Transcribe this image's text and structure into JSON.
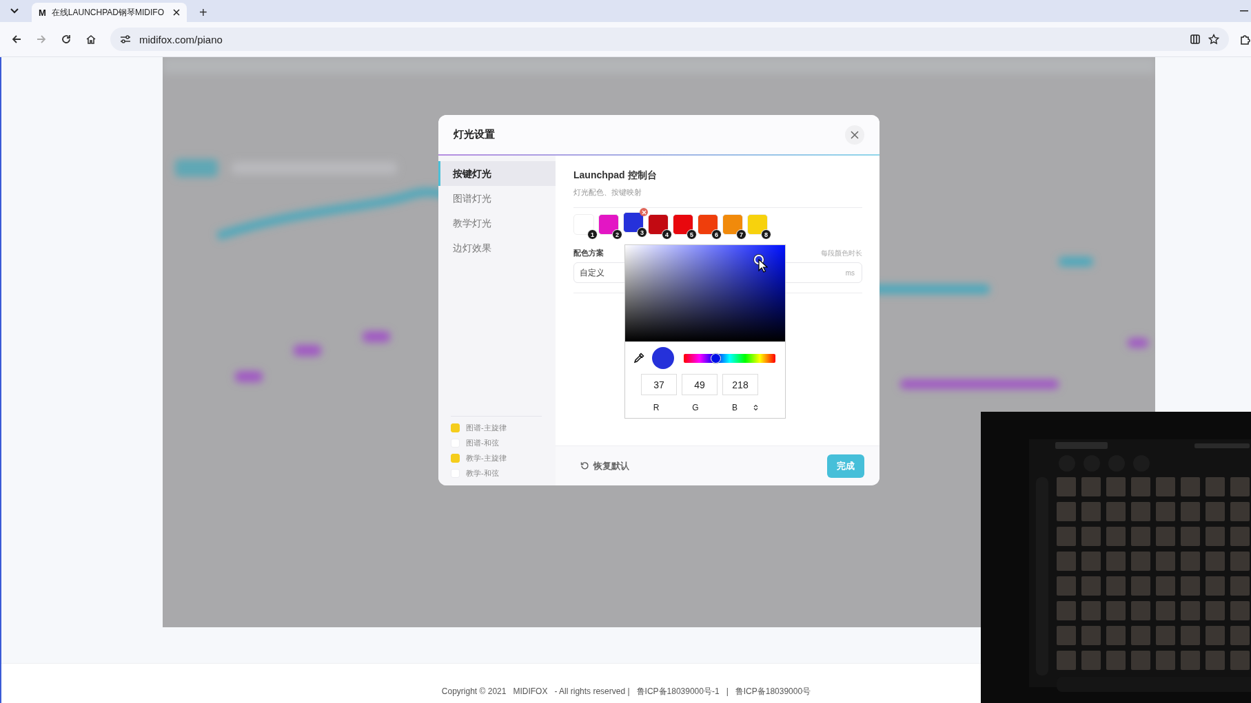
{
  "browser": {
    "tabs": [
      {
        "favicon": "M",
        "title": "在线LAUNCHPAD钢琴MIDIFO",
        "selected": true
      }
    ],
    "new_tab": "+",
    "url": "midifox.com/piano"
  },
  "dialog": {
    "title": "灯光设置",
    "nav": [
      {
        "label": "按键灯光",
        "selected": true
      },
      {
        "label": "图谱灯光",
        "selected": false
      },
      {
        "label": "教学灯光",
        "selected": false
      },
      {
        "label": "边灯效果",
        "selected": false
      }
    ],
    "legend": [
      {
        "label": "图谱-主旋律",
        "checked": true
      },
      {
        "label": "图谱-和弦",
        "checked": false
      },
      {
        "label": "教学-主旋律",
        "checked": true
      },
      {
        "label": "教学-和弦",
        "checked": false
      }
    ],
    "heading": "Launchpad 控制台",
    "subtitle": "灯光配色、按键映射",
    "swatches": [
      {
        "number": "1",
        "color": "#ffffff",
        "selected": false
      },
      {
        "number": "2",
        "color": "#e316c4",
        "selected": false
      },
      {
        "number": "3",
        "color": "#2531da",
        "selected": true
      },
      {
        "number": "4",
        "color": "#c20a12",
        "selected": false
      },
      {
        "number": "5",
        "color": "#e8080e",
        "selected": false
      },
      {
        "number": "6",
        "color": "#ef3e0c",
        "selected": false
      },
      {
        "number": "7",
        "color": "#f18a0b",
        "selected": false
      },
      {
        "number": "8",
        "color": "#f7d20d",
        "selected": false
      }
    ],
    "scheme_label": "配色方案",
    "scheme_value": "自定义",
    "duration_label": "每段颜色时长",
    "duration_unit": "ms",
    "color_picker": {
      "hue": {
        "level": 0.344
      },
      "r": "37",
      "g": "49",
      "b": "218",
      "labels": [
        "R",
        "G",
        "B"
      ]
    },
    "restore": "恢复默认",
    "done": "完成"
  },
  "footer": "Copyright © 2021   MIDIFOX   - All rights reserved |   鲁ICP备18039000号-1   |   鲁ICP备18039000号"
}
